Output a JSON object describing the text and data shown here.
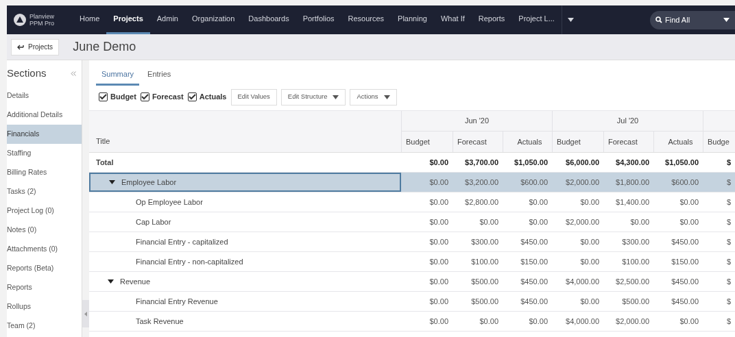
{
  "nav": {
    "logo_line1": "Planview",
    "logo_line2": "PPM Pro",
    "items": [
      {
        "label": "Home",
        "selected": false
      },
      {
        "label": "Projects",
        "selected": true
      },
      {
        "label": "Admin",
        "selected": false
      },
      {
        "label": "Organization",
        "selected": false
      },
      {
        "label": "Dashboards",
        "selected": false
      },
      {
        "label": "Portfolios",
        "selected": false
      },
      {
        "label": "Resources",
        "selected": false
      },
      {
        "label": "Planning",
        "selected": false
      },
      {
        "label": "What If",
        "selected": false
      },
      {
        "label": "Reports",
        "selected": false
      },
      {
        "label": "Project L...",
        "selected": false
      }
    ],
    "search": "Find All"
  },
  "header": {
    "back_button": "Projects",
    "title": "June Demo"
  },
  "sidebar": {
    "title": "Sections",
    "items": [
      {
        "label": "Details",
        "selected": false
      },
      {
        "label": "Additional Details",
        "selected": false
      },
      {
        "label": "Financials",
        "selected": true
      },
      {
        "label": "Staffing",
        "selected": false
      },
      {
        "label": "Billing Rates",
        "selected": false
      },
      {
        "label": "Tasks (2)",
        "selected": false
      },
      {
        "label": "Project Log (0)",
        "selected": false
      },
      {
        "label": "Notes (0)",
        "selected": false
      },
      {
        "label": "Attachments (0)",
        "selected": false
      },
      {
        "label": "Reports (Beta)",
        "selected": false
      },
      {
        "label": "Reports",
        "selected": false
      },
      {
        "label": "Rollups",
        "selected": false
      },
      {
        "label": "Team (2)",
        "selected": false
      }
    ]
  },
  "tabs": [
    {
      "label": "Summary",
      "selected": true
    },
    {
      "label": "Entries",
      "selected": false
    }
  ],
  "toolbar": {
    "checkboxes": [
      {
        "label": "Budget",
        "checked": true
      },
      {
        "label": "Forecast",
        "checked": true
      },
      {
        "label": "Actuals",
        "checked": true
      }
    ],
    "buttons": [
      {
        "label": "Edit Values",
        "dropdown": false
      },
      {
        "label": "Edit Structure",
        "dropdown": true
      },
      {
        "label": "Actions",
        "dropdown": true
      }
    ]
  },
  "table": {
    "title_column": "Title",
    "groups": [
      "Jun '20",
      "Jul '20"
    ],
    "columns": [
      "Budget",
      "Forecast",
      "Actuals",
      "Budget",
      "Forecast",
      "Actuals",
      "Budge"
    ],
    "total": {
      "title": "Total",
      "values": [
        "$0.00",
        "$3,700.00",
        "$1,050.00",
        "$6,000.00",
        "$4,300.00",
        "$1,050.00",
        "$"
      ]
    },
    "rows": [
      {
        "title": "Employee Labor",
        "expanded": true,
        "selected": true,
        "values": [
          "$0.00",
          "$3,200.00",
          "$600.00",
          "$2,000.00",
          "$1,800.00",
          "$600.00",
          "$"
        ],
        "children": [
          {
            "title": "Op Employee Labor",
            "selected": false,
            "values": [
              "$0.00",
              "$2,800.00",
              "$0.00",
              "$0.00",
              "$1,400.00",
              "$0.00",
              "$"
            ]
          },
          {
            "title": "Cap Labor",
            "selected": false,
            "values": [
              "$0.00",
              "$0.00",
              "$0.00",
              "$2,000.00",
              "$0.00",
              "$0.00",
              "$"
            ]
          },
          {
            "title": "Financial Entry - capitalized",
            "selected": false,
            "values": [
              "$0.00",
              "$300.00",
              "$450.00",
              "$0.00",
              "$300.00",
              "$450.00",
              "$"
            ]
          },
          {
            "title": "Financial Entry - non-capitalized",
            "selected": false,
            "values": [
              "$0.00",
              "$100.00",
              "$150.00",
              "$0.00",
              "$100.00",
              "$150.00",
              "$"
            ]
          }
        ]
      },
      {
        "title": "Revenue",
        "expanded": true,
        "selected": false,
        "values": [
          "$0.00",
          "$500.00",
          "$450.00",
          "$4,000.00",
          "$2,500.00",
          "$450.00",
          "$"
        ],
        "children": [
          {
            "title": "Financial Entry Revenue",
            "selected": false,
            "values": [
              "$0.00",
              "$500.00",
              "$450.00",
              "$0.00",
              "$500.00",
              "$450.00",
              "$"
            ]
          },
          {
            "title": "Task Revenue",
            "selected": false,
            "values": [
              "$0.00",
              "$0.00",
              "$0.00",
              "$4,000.00",
              "$2,000.00",
              "$0.00",
              "$"
            ]
          }
        ]
      }
    ]
  }
}
